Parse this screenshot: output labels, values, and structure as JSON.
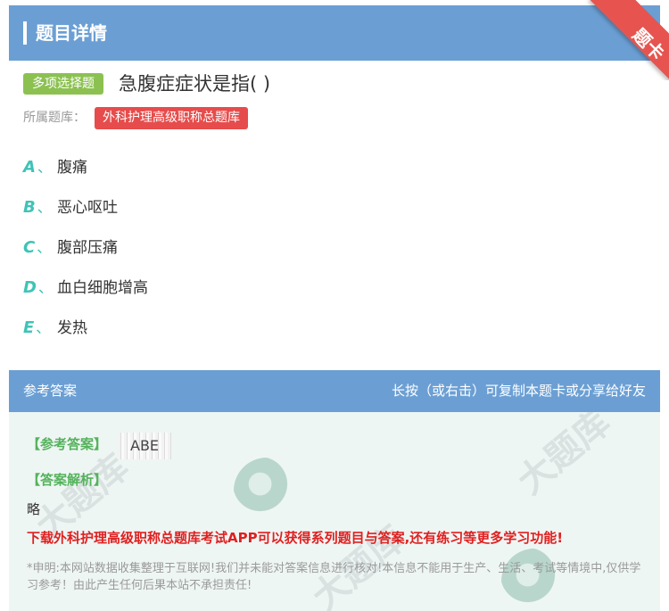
{
  "header": {
    "title": "题目详情"
  },
  "ribbon": {
    "label": "题卡"
  },
  "question": {
    "type_label": "多项选择题",
    "text": "急腹症症状是指( )",
    "bank_label": "所属题库：",
    "bank_name": "外科护理高级职称总题库"
  },
  "options": [
    {
      "letter": "A",
      "sep": "、",
      "text": "腹痛"
    },
    {
      "letter": "B",
      "sep": "、",
      "text": "恶心呕吐"
    },
    {
      "letter": "C",
      "sep": "、",
      "text": "腹部压痛"
    },
    {
      "letter": "D",
      "sep": "、",
      "text": "血白细胞增高"
    },
    {
      "letter": "E",
      "sep": "、",
      "text": "发热"
    }
  ],
  "answer": {
    "section_title": "参考答案",
    "hint": "长按（或右击）可复制本题卡或分享给好友",
    "answer_label": "【参考答案】",
    "answer_value": "ABE",
    "analysis_label": "【答案解析】",
    "analysis_text": "略",
    "promo": "下载外科护理高级职称总题库考试APP可以获得系列题目与答案,还有练习等更多学习功能!",
    "disclaimer": "*申明:本网站数据收集整理于互联网!我们并未能对答案信息进行核对!本信息不能用于生产、生活、考试等情境中,仅供学习参考！由此产生任何后果本站不承担责任!"
  },
  "colors": {
    "header_bg": "#6b9fd4",
    "type_badge": "#8cc152",
    "bank_badge": "#e74c4c",
    "option_letter": "#3fc3b7",
    "answer_label": "#55b25c",
    "promo": "#e02020",
    "ribbon": "#e7544f"
  }
}
